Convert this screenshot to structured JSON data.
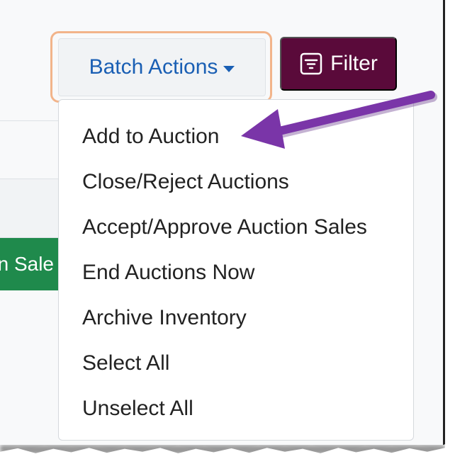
{
  "toolbar": {
    "batch_actions_label": "Batch Actions",
    "filter_label": "Filter",
    "partial_button_label": "n Sale"
  },
  "dropdown": {
    "items": [
      {
        "label": "Add to Auction"
      },
      {
        "label": "Close/Reject Auctions"
      },
      {
        "label": "Accept/Approve Auction Sales"
      },
      {
        "label": "End Auctions Now"
      },
      {
        "label": "Archive Inventory"
      },
      {
        "label": "Select All"
      },
      {
        "label": "Unselect All"
      }
    ]
  },
  "icons": {
    "filter": "filter-icon",
    "caret": "caret-down-icon",
    "annotation": "arrow-annotation"
  },
  "colors": {
    "batch_text": "#1a5fb4",
    "highlight_border": "#f2b48a",
    "filter_bg": "#5a0a3a",
    "green_button": "#1f8a4c",
    "arrow": "#7a35a8"
  }
}
